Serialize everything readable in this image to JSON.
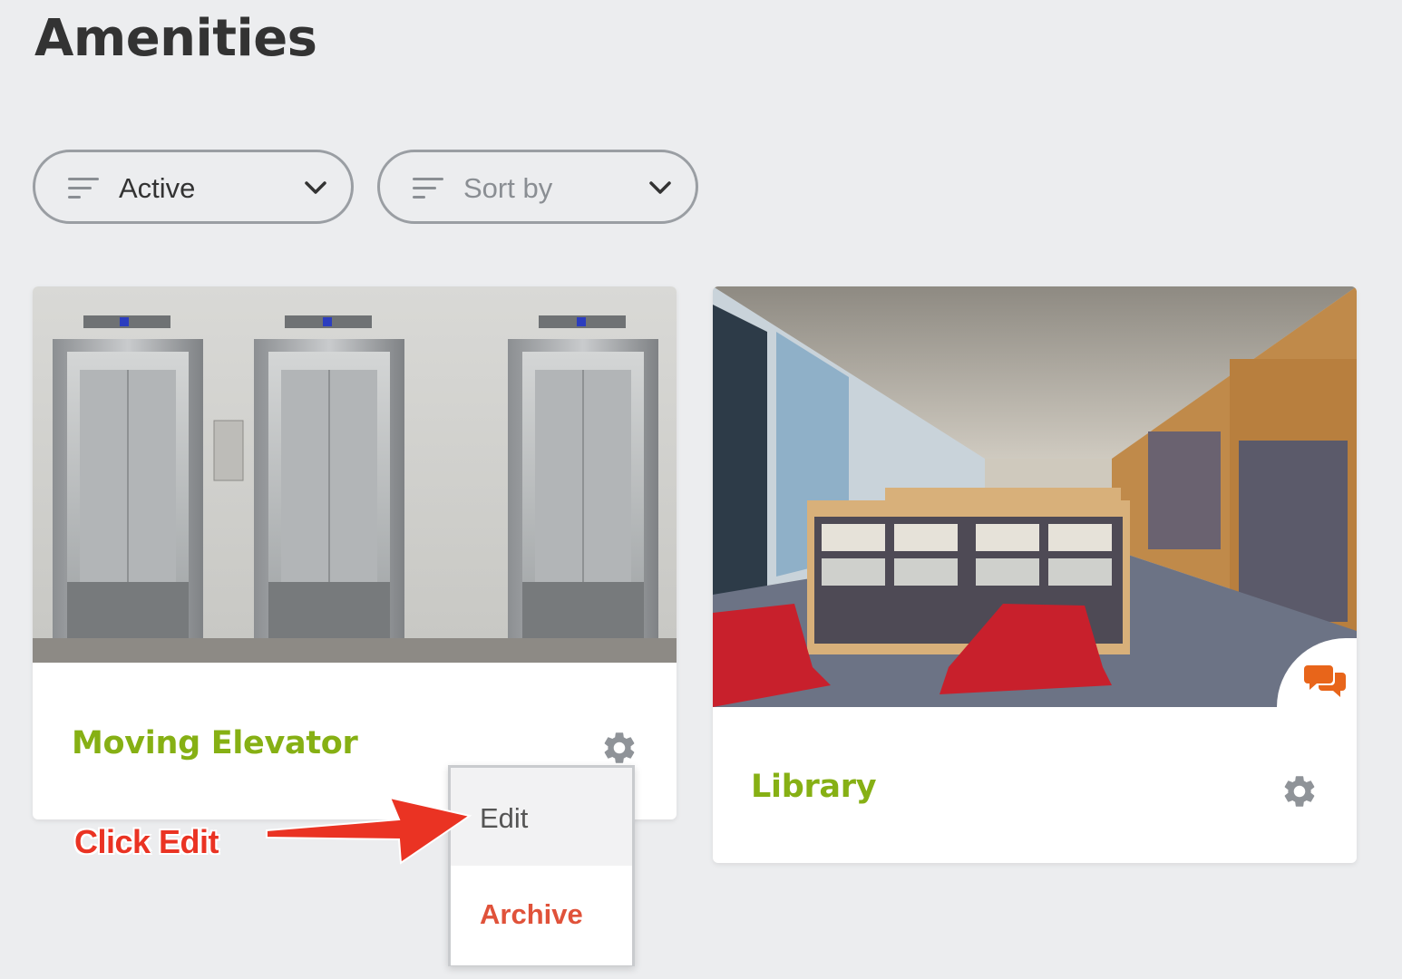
{
  "page": {
    "title": "Amenities"
  },
  "filters": {
    "status": {
      "label": "Active"
    },
    "sort": {
      "placeholder": "Sort by"
    }
  },
  "cards": [
    {
      "title": "Moving Elevator",
      "image": "elevator-lobby-photo"
    },
    {
      "title": "Library",
      "image": "library-interior-photo",
      "badge_icon": "chat-bubbles-icon"
    }
  ],
  "menu": {
    "items": [
      "Edit",
      "Archive"
    ]
  },
  "annotation": {
    "text": "Click Edit"
  },
  "colors": {
    "title_green": "#86b014",
    "archive_red": "#e0523a",
    "annotation_red": "#ea3323",
    "chat_orange": "#e8651a"
  }
}
